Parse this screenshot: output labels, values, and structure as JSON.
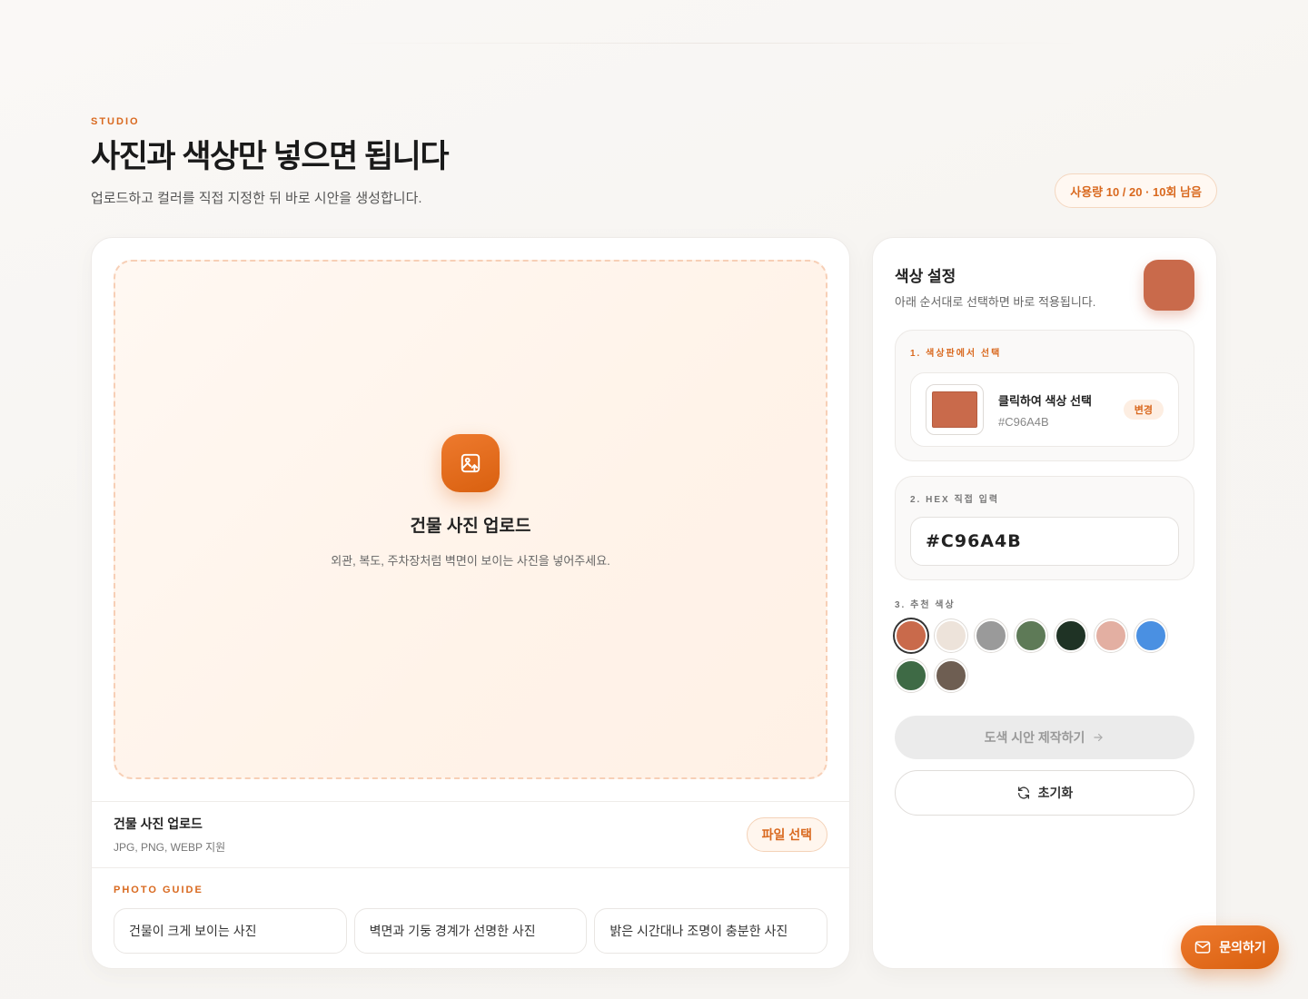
{
  "header": {
    "eyebrow": "STUDIO",
    "title": "사진과 색상만 넣으면 됩니다",
    "subtitle": "업로드하고 컬러를 직접 지정한 뒤 바로 시안을 생성합니다.",
    "usage": "사용량 10 / 20 · 10회 남음"
  },
  "upload": {
    "dropzone_title": "건물 사진 업로드",
    "dropzone_desc": "외관, 복도, 주차장처럼 벽면이 보이는 사진을 넣어주세요.",
    "row_title": "건물 사진 업로드",
    "row_formats": "JPG, PNG, WEBP 지원",
    "file_button": "파일 선택"
  },
  "guide": {
    "label": "PHOTO GUIDE",
    "items": [
      "건물이 크게 보이는 사진",
      "벽면과 기둥 경계가 선명한 사진",
      "밝은 시간대나 조명이 충분한 사진"
    ]
  },
  "color_settings": {
    "title": "색상 설정",
    "desc": "아래 순서대로 선택하면 바로 적용됩니다.",
    "current_color": "#C96A4B",
    "step1_label": "1. 색상판에서 선택",
    "picker_label": "클릭하여 색상 선택",
    "picker_hex": "#C96A4B",
    "change_label": "변경",
    "step2_label": "2. HEX 직접 입력",
    "hex_value": "#C96A4B",
    "step3_label": "3. 추천 색상",
    "recommended": [
      "#C96A4B",
      "#EDE3DA",
      "#9A9A9A",
      "#5E7A57",
      "#1F3325",
      "#E3AFA2",
      "#4A90E2",
      "#3E6A45",
      "#6E5E52"
    ],
    "selected_index": 0,
    "create_label": "도색 시안 제작하기",
    "reset_label": "초기화"
  },
  "contact": {
    "label": "문의하기"
  },
  "icons": {
    "upload": "image-upload-icon",
    "arrow": "arrow-right-icon",
    "reset": "refresh-icon",
    "contact": "mail-icon"
  }
}
